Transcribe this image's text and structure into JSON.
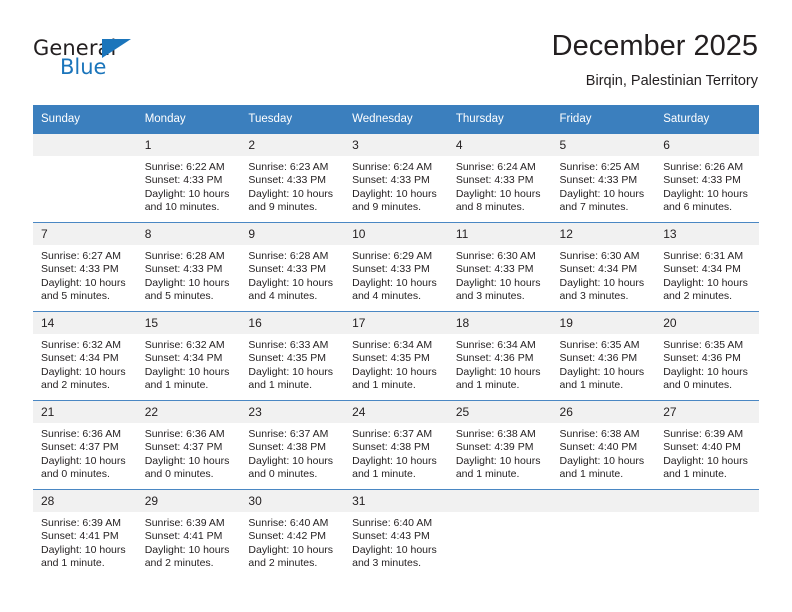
{
  "logo": {
    "word_top": "General",
    "word_bottom": "Blue",
    "accent_color": "#1b75bb",
    "triangle_icon": "triangle-icon"
  },
  "header": {
    "title": "December 2025",
    "subtitle": "Birqin, Palestinian Territory"
  },
  "calendar": {
    "header_color": "#3b7fbe",
    "weekday_headers": [
      "Sunday",
      "Monday",
      "Tuesday",
      "Wednesday",
      "Thursday",
      "Friday",
      "Saturday"
    ],
    "weeks": [
      [
        {
          "day": "",
          "blank": true,
          "sunrise": "",
          "sunset": "",
          "daylight1": "",
          "daylight2": ""
        },
        {
          "day": "1",
          "sunrise": "Sunrise: 6:22 AM",
          "sunset": "Sunset: 4:33 PM",
          "daylight1": "Daylight: 10 hours",
          "daylight2": "and 10 minutes."
        },
        {
          "day": "2",
          "sunrise": "Sunrise: 6:23 AM",
          "sunset": "Sunset: 4:33 PM",
          "daylight1": "Daylight: 10 hours",
          "daylight2": "and 9 minutes."
        },
        {
          "day": "3",
          "sunrise": "Sunrise: 6:24 AM",
          "sunset": "Sunset: 4:33 PM",
          "daylight1": "Daylight: 10 hours",
          "daylight2": "and 9 minutes."
        },
        {
          "day": "4",
          "sunrise": "Sunrise: 6:24 AM",
          "sunset": "Sunset: 4:33 PM",
          "daylight1": "Daylight: 10 hours",
          "daylight2": "and 8 minutes."
        },
        {
          "day": "5",
          "sunrise": "Sunrise: 6:25 AM",
          "sunset": "Sunset: 4:33 PM",
          "daylight1": "Daylight: 10 hours",
          "daylight2": "and 7 minutes."
        },
        {
          "day": "6",
          "sunrise": "Sunrise: 6:26 AM",
          "sunset": "Sunset: 4:33 PM",
          "daylight1": "Daylight: 10 hours",
          "daylight2": "and 6 minutes."
        }
      ],
      [
        {
          "day": "7",
          "sunrise": "Sunrise: 6:27 AM",
          "sunset": "Sunset: 4:33 PM",
          "daylight1": "Daylight: 10 hours",
          "daylight2": "and 5 minutes."
        },
        {
          "day": "8",
          "sunrise": "Sunrise: 6:28 AM",
          "sunset": "Sunset: 4:33 PM",
          "daylight1": "Daylight: 10 hours",
          "daylight2": "and 5 minutes."
        },
        {
          "day": "9",
          "sunrise": "Sunrise: 6:28 AM",
          "sunset": "Sunset: 4:33 PM",
          "daylight1": "Daylight: 10 hours",
          "daylight2": "and 4 minutes."
        },
        {
          "day": "10",
          "sunrise": "Sunrise: 6:29 AM",
          "sunset": "Sunset: 4:33 PM",
          "daylight1": "Daylight: 10 hours",
          "daylight2": "and 4 minutes."
        },
        {
          "day": "11",
          "sunrise": "Sunrise: 6:30 AM",
          "sunset": "Sunset: 4:33 PM",
          "daylight1": "Daylight: 10 hours",
          "daylight2": "and 3 minutes."
        },
        {
          "day": "12",
          "sunrise": "Sunrise: 6:30 AM",
          "sunset": "Sunset: 4:34 PM",
          "daylight1": "Daylight: 10 hours",
          "daylight2": "and 3 minutes."
        },
        {
          "day": "13",
          "sunrise": "Sunrise: 6:31 AM",
          "sunset": "Sunset: 4:34 PM",
          "daylight1": "Daylight: 10 hours",
          "daylight2": "and 2 minutes."
        }
      ],
      [
        {
          "day": "14",
          "sunrise": "Sunrise: 6:32 AM",
          "sunset": "Sunset: 4:34 PM",
          "daylight1": "Daylight: 10 hours",
          "daylight2": "and 2 minutes."
        },
        {
          "day": "15",
          "sunrise": "Sunrise: 6:32 AM",
          "sunset": "Sunset: 4:34 PM",
          "daylight1": "Daylight: 10 hours",
          "daylight2": "and 1 minute."
        },
        {
          "day": "16",
          "sunrise": "Sunrise: 6:33 AM",
          "sunset": "Sunset: 4:35 PM",
          "daylight1": "Daylight: 10 hours",
          "daylight2": "and 1 minute."
        },
        {
          "day": "17",
          "sunrise": "Sunrise: 6:34 AM",
          "sunset": "Sunset: 4:35 PM",
          "daylight1": "Daylight: 10 hours",
          "daylight2": "and 1 minute."
        },
        {
          "day": "18",
          "sunrise": "Sunrise: 6:34 AM",
          "sunset": "Sunset: 4:36 PM",
          "daylight1": "Daylight: 10 hours",
          "daylight2": "and 1 minute."
        },
        {
          "day": "19",
          "sunrise": "Sunrise: 6:35 AM",
          "sunset": "Sunset: 4:36 PM",
          "daylight1": "Daylight: 10 hours",
          "daylight2": "and 1 minute."
        },
        {
          "day": "20",
          "sunrise": "Sunrise: 6:35 AM",
          "sunset": "Sunset: 4:36 PM",
          "daylight1": "Daylight: 10 hours",
          "daylight2": "and 0 minutes."
        }
      ],
      [
        {
          "day": "21",
          "sunrise": "Sunrise: 6:36 AM",
          "sunset": "Sunset: 4:37 PM",
          "daylight1": "Daylight: 10 hours",
          "daylight2": "and 0 minutes."
        },
        {
          "day": "22",
          "sunrise": "Sunrise: 6:36 AM",
          "sunset": "Sunset: 4:37 PM",
          "daylight1": "Daylight: 10 hours",
          "daylight2": "and 0 minutes."
        },
        {
          "day": "23",
          "sunrise": "Sunrise: 6:37 AM",
          "sunset": "Sunset: 4:38 PM",
          "daylight1": "Daylight: 10 hours",
          "daylight2": "and 0 minutes."
        },
        {
          "day": "24",
          "sunrise": "Sunrise: 6:37 AM",
          "sunset": "Sunset: 4:38 PM",
          "daylight1": "Daylight: 10 hours",
          "daylight2": "and 1 minute."
        },
        {
          "day": "25",
          "sunrise": "Sunrise: 6:38 AM",
          "sunset": "Sunset: 4:39 PM",
          "daylight1": "Daylight: 10 hours",
          "daylight2": "and 1 minute."
        },
        {
          "day": "26",
          "sunrise": "Sunrise: 6:38 AM",
          "sunset": "Sunset: 4:40 PM",
          "daylight1": "Daylight: 10 hours",
          "daylight2": "and 1 minute."
        },
        {
          "day": "27",
          "sunrise": "Sunrise: 6:39 AM",
          "sunset": "Sunset: 4:40 PM",
          "daylight1": "Daylight: 10 hours",
          "daylight2": "and 1 minute."
        }
      ],
      [
        {
          "day": "28",
          "sunrise": "Sunrise: 6:39 AM",
          "sunset": "Sunset: 4:41 PM",
          "daylight1": "Daylight: 10 hours",
          "daylight2": "and 1 minute."
        },
        {
          "day": "29",
          "sunrise": "Sunrise: 6:39 AM",
          "sunset": "Sunset: 4:41 PM",
          "daylight1": "Daylight: 10 hours",
          "daylight2": "and 2 minutes."
        },
        {
          "day": "30",
          "sunrise": "Sunrise: 6:40 AM",
          "sunset": "Sunset: 4:42 PM",
          "daylight1": "Daylight: 10 hours",
          "daylight2": "and 2 minutes."
        },
        {
          "day": "31",
          "sunrise": "Sunrise: 6:40 AM",
          "sunset": "Sunset: 4:43 PM",
          "daylight1": "Daylight: 10 hours",
          "daylight2": "and 3 minutes."
        },
        {
          "day": "",
          "blank": true,
          "sunrise": "",
          "sunset": "",
          "daylight1": "",
          "daylight2": ""
        },
        {
          "day": "",
          "blank": true,
          "sunrise": "",
          "sunset": "",
          "daylight1": "",
          "daylight2": ""
        },
        {
          "day": "",
          "blank": true,
          "sunrise": "",
          "sunset": "",
          "daylight1": "",
          "daylight2": ""
        }
      ]
    ]
  }
}
